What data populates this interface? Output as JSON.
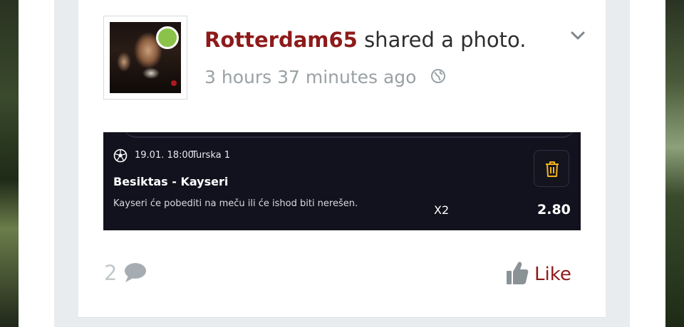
{
  "post": {
    "author": "Rotterdam65",
    "action": "shared a photo.",
    "time": "3 hours 37 minutes ago",
    "privacy_icon": "globe-icon",
    "menu_icon": "chevron-down-icon",
    "online": true
  },
  "ticket": {
    "date": "19.01. 18:00",
    "league": "Turska 1",
    "match": "Besiktas - Kayseri",
    "description": "Kayseri će pobediti na meču ili će ishod biti nerešen.",
    "pick": "X2",
    "odds": "2.80",
    "sport_icon": "soccer-ball-icon",
    "remove_icon": "trash-icon"
  },
  "footer": {
    "comment_count": "2",
    "comment_icon": "comment-bubble-icon",
    "like_label": "Like",
    "like_icon": "thumbs-up-icon"
  },
  "colors": {
    "author": "#8e1a1a",
    "like": "#8e1a1a",
    "online": "#8bc34a",
    "ticket_bg": "#12121e",
    "trash": "#f2b31b"
  }
}
